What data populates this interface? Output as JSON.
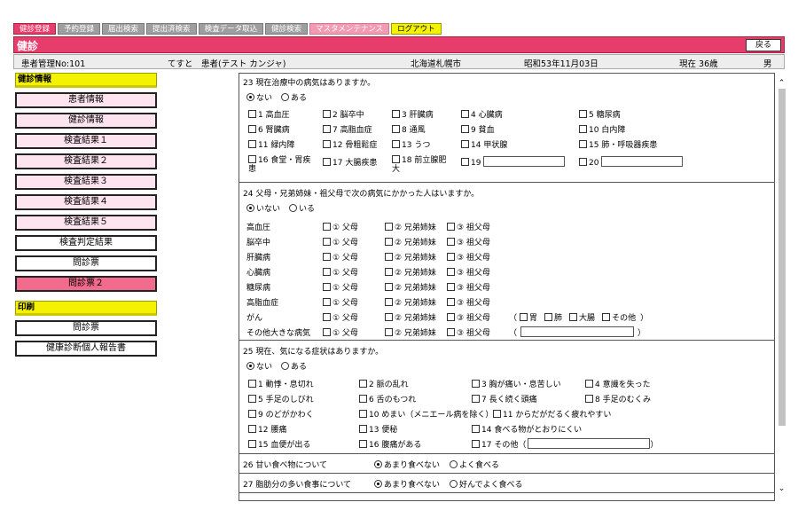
{
  "nav": [
    "健診登録",
    "予約登録",
    "届出検索",
    "提出済検索",
    "検査データ取込",
    "健診検索",
    "マスタメンテナンス",
    "ログアウト"
  ],
  "title": "健診",
  "back_label": "戻る",
  "patient": {
    "id": "患者管理No:101",
    "name": "てすと　患者(テスト カンジャ)",
    "address": "北海道札幌市",
    "dob": "昭和53年11月03日",
    "age": "現在 36歳",
    "sex": "男"
  },
  "sidebar": {
    "section1": "健診情報",
    "items1": [
      "患者情報",
      "健診情報",
      "検査結果１",
      "検査結果２",
      "検査結果３",
      "検査結果４",
      "検査結果５",
      "検査判定結果",
      "問診票",
      "問診票２"
    ],
    "section2": "印刷",
    "items2": [
      "問診票",
      "健康診断個人報告書"
    ]
  },
  "q23": {
    "question": "23 現在治療中の病気はありますか。",
    "opt_no": "ない",
    "opt_yes": "ある",
    "items": [
      "1 高血圧",
      "2 脳卒中",
      "3 肝臓病",
      "4 心臓病",
      "5 糖尿病",
      "6 腎臓病",
      "7 高脂血症",
      "8 通風",
      "9 貧血",
      "10 白内障",
      "11 緑内障",
      "12 骨粗鬆症",
      "13 うつ",
      "14 甲状腺",
      "15 肺・呼吸器疾患",
      "16 食堂・胃疾",
      "患",
      "17 大腸疾患",
      "18 前立腺肥",
      "大",
      "19",
      "20"
    ]
  },
  "q24": {
    "question": "24  父母・兄弟姉妹・祖父母で次の病気にかかった人はいますか。",
    "opt_no": "いない",
    "opt_yes": "いる",
    "rel1": "① 父母",
    "rel2": "② 兄弟姉妹",
    "rel3": "③ 祖父母",
    "diseases": [
      "高血圧",
      "脳卒中",
      "肝臓病",
      "心臓病",
      "糖尿病",
      "高脂血症",
      "がん",
      "その他大きな病気"
    ],
    "cancer_paren_open": "（",
    "cancer_opts": [
      "胃",
      "肺",
      "大腸",
      "その他"
    ],
    "cancer_paren_close": "）",
    "other_paren_open": "（",
    "other_paren_close": "）"
  },
  "q25": {
    "question": "25 現在、気になる症状はありますか。",
    "opt_no": "ない",
    "opt_yes": "ある",
    "items": [
      "1 動悸・息切れ",
      "2 脈の乱れ",
      "3 胸が痛い・息苦しい",
      "4 意識を失った",
      "5 手足のしびれ",
      "6 舌のもつれ",
      "7 長く続く頭痛",
      "8 手足のむくみ",
      "9 のどがかわく",
      "10 めまい（メニエール病を除く）",
      "11 からだがだるく疲れやすい",
      "12 腰痛",
      "13 便秘",
      "14 食べる物がとおりにくい",
      "15 血便が出る",
      "16 腹痛がある",
      "17 その他（",
      "）"
    ]
  },
  "q26": {
    "question": "26  甘い食べ物について",
    "opt1": "あまり食べない",
    "opt2": "よく食べる"
  },
  "q27": {
    "question": "27  脂肪分の多い食事について",
    "opt1": "あまり食べない",
    "opt2": "好んでよく食べる"
  }
}
